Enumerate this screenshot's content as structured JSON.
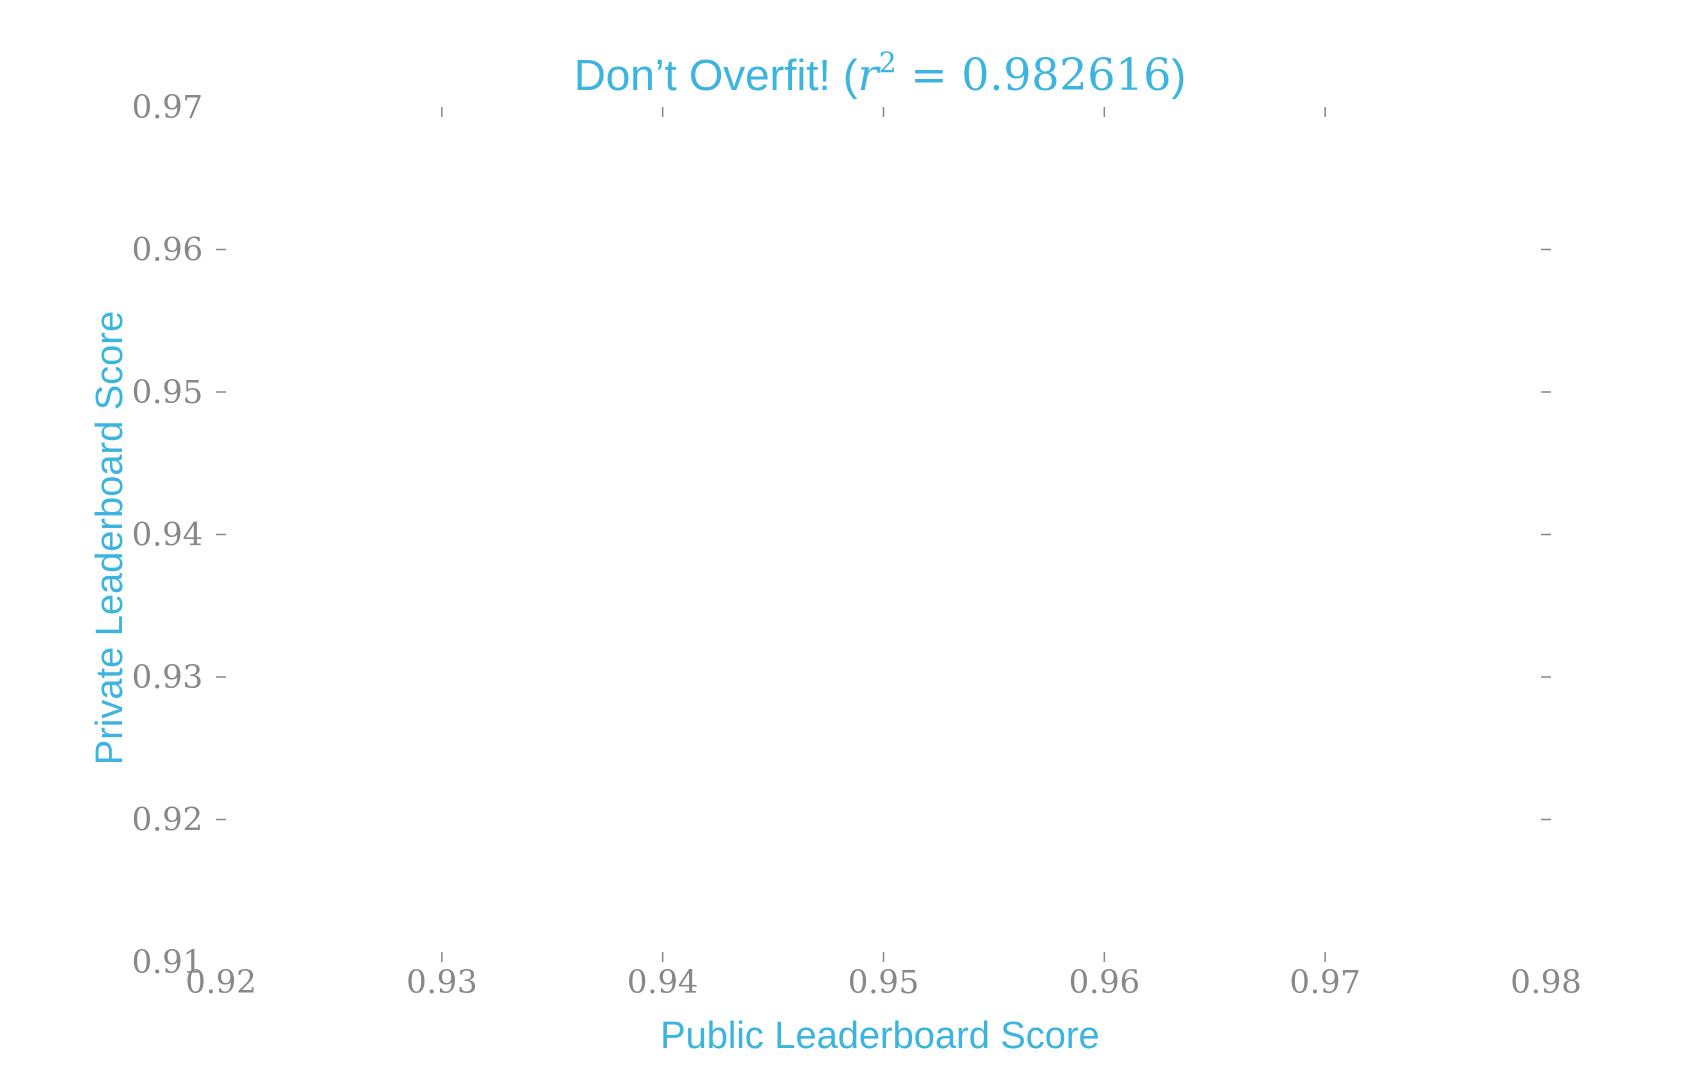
{
  "chart_data": {
    "type": "scatter",
    "title_prefix": "Don’t Overfit! (",
    "title_math_r": "r",
    "title_math_sup": "2",
    "title_math_rest": " = 0.982616",
    "title_suffix": ")",
    "xlabel": "Public Leaderboard Score",
    "ylabel": "Private Leaderboard Score",
    "xlim": [
      0.92,
      0.98
    ],
    "ylim": [
      0.91,
      0.97
    ],
    "xticks": [
      "0.92",
      "0.93",
      "0.94",
      "0.95",
      "0.96",
      "0.97",
      "0.98"
    ],
    "yticks": [
      "0.91",
      "0.92",
      "0.93",
      "0.94",
      "0.95",
      "0.96",
      "0.97"
    ],
    "grid": false,
    "points": [],
    "colors": {
      "accent": "#3cb4e0",
      "tick": "#888888"
    }
  }
}
